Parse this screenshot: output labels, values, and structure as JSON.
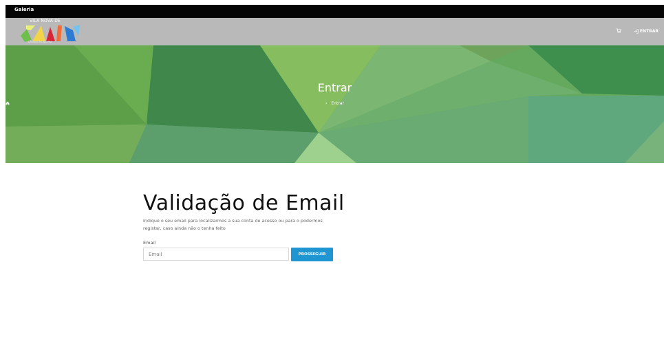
{
  "topbar": {
    "label": "Galeria"
  },
  "header": {
    "logo": {
      "title": "VILA NOVA DE",
      "word": "GAIA",
      "subtitle": "CÂMARA MUNICIPAL"
    },
    "nav": {
      "login_label": "ENTRAR"
    }
  },
  "hero": {
    "title": "Entrar",
    "breadcrumb": {
      "separator": "›",
      "current": "Entrar"
    }
  },
  "content": {
    "heading": "Validação de Email",
    "description": "Indique o seu email para localizarmos a sua conta de acesso ou para o podermos registar, caso ainda não o tenha feito",
    "form": {
      "email_label": "Email",
      "email_placeholder": "Email",
      "email_value": "",
      "submit_label": "PROSSEGUIR"
    }
  },
  "colors": {
    "topbar": "#050505",
    "navbar": "#b9b9b9",
    "hero_green": "#62a55e",
    "primary_button": "#1f95d2"
  }
}
